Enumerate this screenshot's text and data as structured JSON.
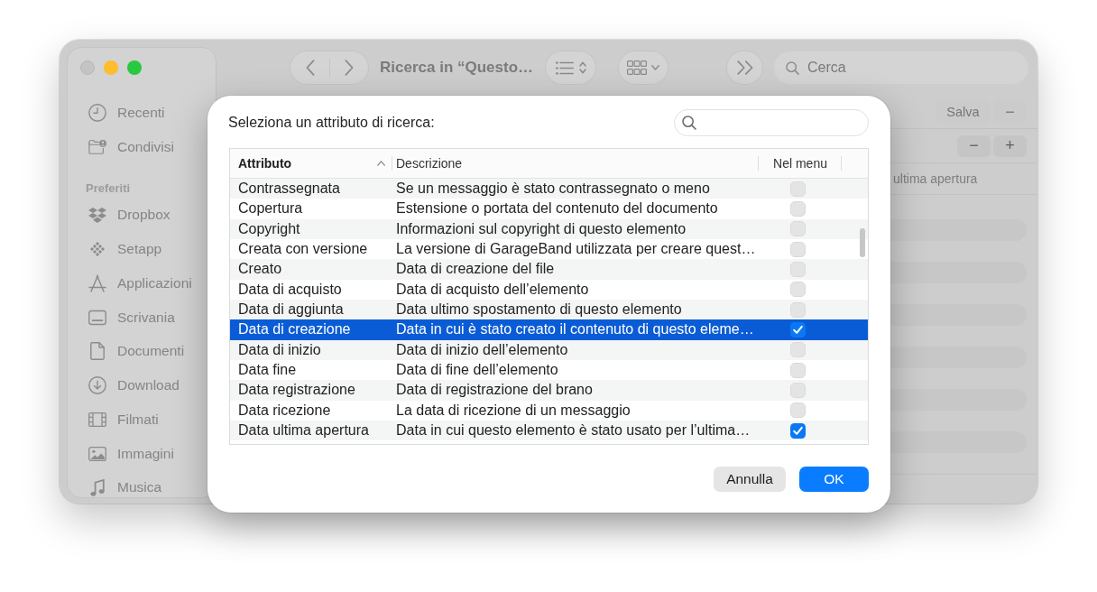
{
  "finder_window": {
    "traffic_lights": [
      {
        "kind": "close",
        "enabled": false
      },
      {
        "kind": "minimize",
        "enabled": true
      },
      {
        "kind": "zoom",
        "enabled": true
      }
    ],
    "toolbar": {
      "title": "Ricerca in “Questo…",
      "search": {
        "placeholder": "Cerca"
      }
    },
    "sidebar": {
      "items": [
        {
          "label": "Recenti"
        },
        {
          "label": "Condivisi"
        }
      ],
      "sections": [
        {
          "title": "Preferiti",
          "items": [
            {
              "label": "Dropbox"
            },
            {
              "label": "Setapp"
            },
            {
              "label": "Applicazioni"
            },
            {
              "label": "Scrivania"
            },
            {
              "label": "Documenti"
            },
            {
              "label": "Download"
            },
            {
              "label": "Filmati"
            },
            {
              "label": "Immagini"
            },
            {
              "label": "Musica"
            }
          ]
        }
      ]
    },
    "search_bar": {
      "buttons": [
        {
          "label": "Salva",
          "disabled": true
        },
        {
          "label": "−",
          "disabled": true
        }
      ]
    },
    "criteria": [
      {
        "buttons": [
          {
            "label": "−",
            "disabled": false
          },
          {
            "label": "+",
            "disabled": false
          }
        ]
      }
    ],
    "results": {
      "column_header": "ultima apertura"
    }
  },
  "dialog": {
    "prompt": "Seleziona un attributo di ricerca:",
    "table": {
      "columns": [
        {
          "label": "Attributo",
          "sorted": true
        },
        {
          "label": "Descrizione",
          "sorted": false
        },
        {
          "label": "Nel menu",
          "sorted": false
        }
      ],
      "rows": [
        {
          "attribute": "Contrassegnata",
          "description": "Se un messaggio è stato contrassegnato o meno",
          "in_menu": false,
          "selected": false
        },
        {
          "attribute": "Copertura",
          "description": "Estensione o portata del contenuto del documento",
          "in_menu": false,
          "selected": false
        },
        {
          "attribute": "Copyright",
          "description": "Informazioni sul copyright di questo elemento",
          "in_menu": false,
          "selected": false
        },
        {
          "attribute": "Creata con versione",
          "description": "La versione di GarageBand utilizzata per creare quest…",
          "in_menu": false,
          "selected": false
        },
        {
          "attribute": "Creato",
          "description": "Data di creazione del file",
          "in_menu": false,
          "selected": false
        },
        {
          "attribute": "Data di acquisto",
          "description": "Data di acquisto dell’elemento",
          "in_menu": false,
          "selected": false
        },
        {
          "attribute": "Data di aggiunta",
          "description": "Data ultimo spostamento di questo elemento",
          "in_menu": false,
          "selected": false
        },
        {
          "attribute": "Data di creazione",
          "description": "Data in cui è stato creato il contenuto di questo eleme…",
          "in_menu": true,
          "selected": true
        },
        {
          "attribute": "Data di inizio",
          "description": "Data di inizio dell’elemento",
          "in_menu": false,
          "selected": false
        },
        {
          "attribute": "Data fine",
          "description": "Data di fine dell’elemento",
          "in_menu": false,
          "selected": false
        },
        {
          "attribute": "Data registrazione",
          "description": "Data di registrazione del brano",
          "in_menu": false,
          "selected": false
        },
        {
          "attribute": "Data ricezione",
          "description": "La data di ricezione di un messaggio",
          "in_menu": false,
          "selected": false
        },
        {
          "attribute": "Data ultima apertura",
          "description": "Data in cui questo elemento è stato usato per l’ultima…",
          "in_menu": true,
          "selected": false
        }
      ]
    },
    "buttons": [
      {
        "label": "Annulla",
        "kind": "secondary"
      },
      {
        "label": "OK",
        "kind": "primary"
      }
    ]
  }
}
